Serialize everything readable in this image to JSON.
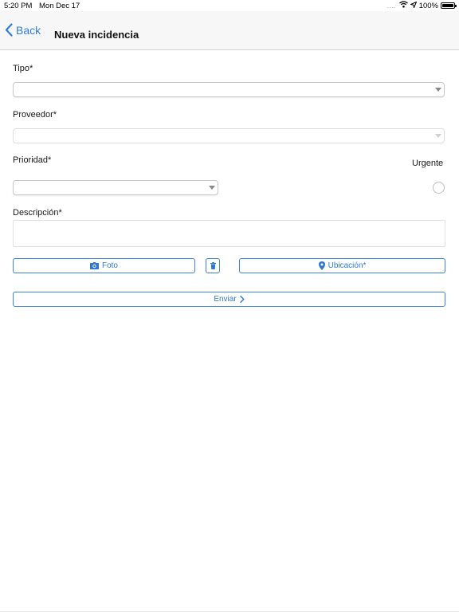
{
  "status_bar": {
    "time": "5:20 PM",
    "date": "Mon Dec 17",
    "signal": "....",
    "battery": "100%",
    "battery_level": 1.0
  },
  "nav": {
    "back_label": "Back",
    "title": "Nueva incidencia"
  },
  "form": {
    "tipo": {
      "label": "Tipo*",
      "value": ""
    },
    "proveedor": {
      "label": "Proveedor*",
      "value": ""
    },
    "prioridad": {
      "label": "Prioridad*",
      "value": ""
    },
    "urgente": {
      "label": "Urgente",
      "checked": false
    },
    "descripcion": {
      "label": "Descripción*",
      "value": ""
    }
  },
  "actions": {
    "foto_label": "Foto",
    "ubicacion_label": "Ubicación*",
    "enviar_label": "Enviar"
  },
  "colors": {
    "accent": "#2f7ddc",
    "nav_background": "#f7f7f7",
    "border": "#c8c8c8"
  },
  "icons": {
    "back": "chevron-left-icon",
    "wifi": "wifi-icon",
    "location_arrow": "location-arrow-icon",
    "battery": "battery-icon",
    "camera": "camera-icon",
    "trash": "trash-icon",
    "map_pin": "map-pin-icon",
    "chevron_right": "chevron-right-icon"
  }
}
